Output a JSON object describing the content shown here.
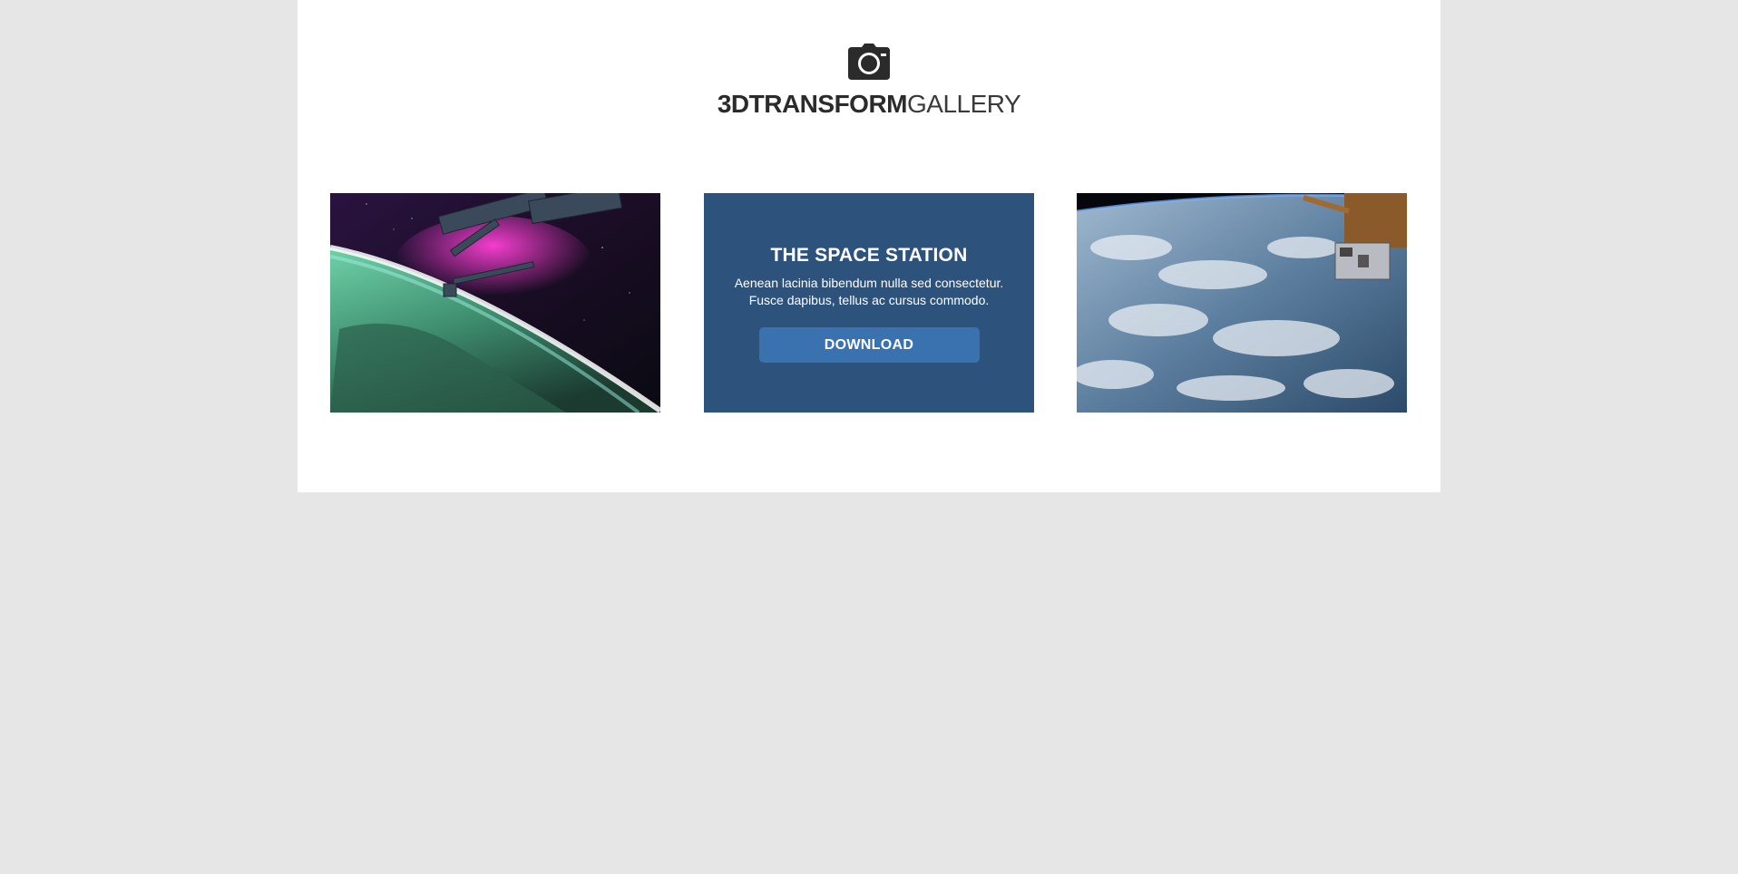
{
  "header": {
    "logo_icon": "camera-icon",
    "logo_bold": "3DTRANSFORM",
    "logo_light": "GALLERY"
  },
  "gallery": {
    "images": [
      {
        "subject": "aurora-over-earth-from-space-station"
      },
      {
        "subject": "earth-clouds-with-spacecraft-module"
      }
    ],
    "card": {
      "title": "THE SPACE STATION",
      "text_line1": "Aenean lacinia bibendum nulla sed consectetur.",
      "text_line2": "Fusce dapibus, tellus ac cursus commodo.",
      "button_label": "DOWNLOAD"
    }
  },
  "colors": {
    "background": "#e6e6e6",
    "page": "#ffffff",
    "card": "#2d537c",
    "button": "#3a72b0",
    "logo": "#2b2b2b"
  }
}
